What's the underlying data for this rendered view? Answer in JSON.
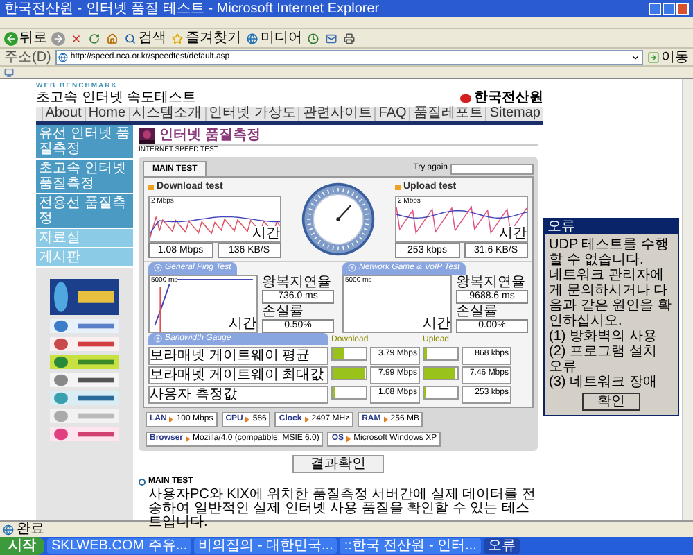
{
  "window": {
    "title": "한국전산원 - 인터넷 품질 테스트 - Microsoft Internet Explorer"
  },
  "toolbar": [
    {
      "kind": "back",
      "label": "뒤로"
    },
    {
      "kind": "forward"
    },
    {
      "kind": "stop"
    },
    {
      "kind": "refresh"
    },
    {
      "kind": "home"
    },
    {
      "kind": "search",
      "label": "검색"
    },
    {
      "kind": "favorites",
      "label": "즐겨찾기"
    },
    {
      "kind": "media",
      "label": "미디어"
    },
    {
      "kind": "history"
    },
    {
      "kind": "mail"
    },
    {
      "kind": "print"
    }
  ],
  "address_bar": {
    "label": "주소(D)",
    "value": "http://speed.nca.or.kr/speedtest/default.asp",
    "go": "이동"
  },
  "site": {
    "tagline": "WEB BENCHMARK",
    "title": "초고속 인터넷 속도테스트",
    "org": "한국전산원"
  },
  "nav": [
    "About",
    "Home",
    "시스템소개",
    "인터넷 가상도",
    "관련사이트",
    "FAQ",
    "품질레포트",
    "Sitemap"
  ],
  "sidebar": {
    "items": [
      "유선 인터넷 품질측정",
      "초고속 인터넷 품질측정",
      "전용선 품질측정",
      "자료실",
      "게시판"
    ]
  },
  "page_title": {
    "title": "인터넷 품질측정",
    "subtitle": "INTERNET SPEED TEST"
  },
  "test_panel": {
    "tabs": [
      {
        "label": "MAIN TEST",
        "selected": true
      }
    ],
    "try_again": "Try again",
    "download": {
      "title": "Download test",
      "scale": "2 Mbps",
      "axis": "시간",
      "readings": [
        "1.08 Mbps",
        "136 KB/S"
      ]
    },
    "upload": {
      "title": "Upload test",
      "scale": "2 Mbps",
      "axis": "시간",
      "readings": [
        "253 kbps",
        "31.6 KB/S"
      ]
    },
    "ping_tests": [
      {
        "title": "General Ping Test",
        "scale": "5000 ms",
        "axis": "시간",
        "fields": [
          {
            "label": "왕복지연율",
            "value": "736.0 ms"
          },
          {
            "label": "손실률",
            "value": "0.50%"
          }
        ]
      },
      {
        "title": "Network Game & VoIP Test",
        "scale": "5000 ms",
        "axis": "시간",
        "fields": [
          {
            "label": "왕복지연율",
            "value": "9688.6 ms"
          },
          {
            "label": "손실률",
            "value": "0.00%"
          }
        ]
      }
    ],
    "bandwidth": {
      "title": "Bandwidth Gauge",
      "columns": [
        "Download",
        "Upload"
      ],
      "rows": [
        {
          "label": "보라매넷 게이트웨이 평균",
          "download": {
            "level": 0.35,
            "reading": "3.79 Mbps"
          },
          "upload": {
            "level": 0.08,
            "reading": "868 kbps"
          }
        },
        {
          "label": "보라매넷 게이트웨이 최대값",
          "download": {
            "level": 0.95,
            "reading": "7.99 Mbps"
          },
          "upload": {
            "level": 0.9,
            "reading": "7.46 Mbps"
          }
        },
        {
          "label": "사용자 측정값",
          "download": {
            "level": 0.1,
            "reading": "1.08 Mbps"
          },
          "upload": {
            "level": 0.03,
            "reading": "253 kbps"
          }
        }
      ]
    },
    "system_info": [
      {
        "label": "LAN",
        "value": "100 Mbps"
      },
      {
        "label": "CPU",
        "value": "586"
      },
      {
        "label": "Clock",
        "value": "2497 MHz"
      },
      {
        "label": "RAM",
        "value": "256 MB"
      },
      {
        "label": "Browser",
        "value": "Mozilla/4.0 (compatible; MSIE 6.0)"
      },
      {
        "label": "OS",
        "value": "Microsoft Windows XP"
      }
    ]
  },
  "result_button": "결과확인",
  "note": {
    "title": "MAIN TEST",
    "text": "사용자PC와 KIX에 위치한 품질측정 서버간에 실제 데이터를 전송하여 일반적인 실제 인터넷 사용 품질을 확인할 수 있는 테스트입니다."
  },
  "dialog": {
    "title": "오류",
    "lines": [
      "UDP 테스트를 수행할 수 없습니다.",
      "네트워크 관리자에게 문의하시거나 다음과 같은 원인을 확인하십시오.",
      "(1) 방화벽의 사용",
      "(2) 프로그램 설치 오류",
      "(3) 네트워크 장애"
    ],
    "button": "확인"
  },
  "status_bar": {
    "text": "완료"
  },
  "taskbar": {
    "start": "시작",
    "items": [
      {
        "label": "SKLWEB.COM 주유...",
        "selected": false
      },
      {
        "label": "비의집의 - 대한민국...",
        "selected": false
      },
      {
        "label": "::한국 전산원 - 인터...",
        "selected": false
      },
      {
        "label": "오류",
        "selected": true
      }
    ]
  }
}
